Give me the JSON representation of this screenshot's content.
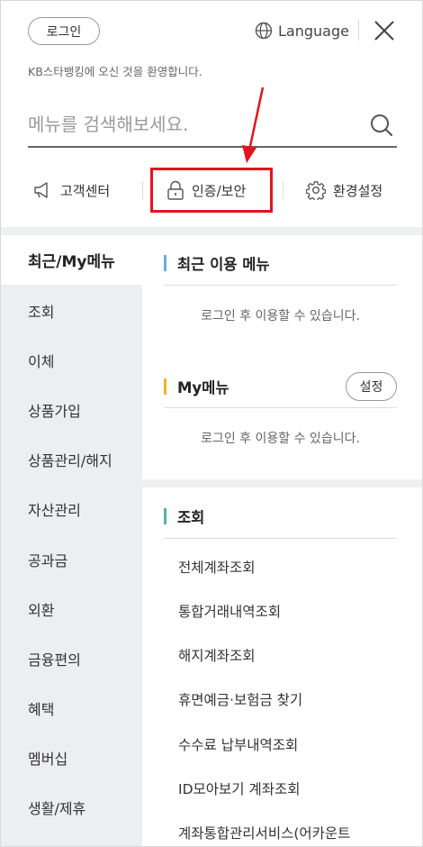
{
  "header": {
    "login_label": "로그인",
    "language_label": "Language",
    "welcome_text": "KB스타뱅킹에 오신 것을 환영합니다."
  },
  "search": {
    "placeholder": "메뉴를 검색해보세요."
  },
  "quick_links": [
    {
      "label": "고객센터",
      "icon": "megaphone-icon"
    },
    {
      "label": "인증/보안",
      "icon": "lock-icon"
    },
    {
      "label": "환경설정",
      "icon": "gear-icon"
    }
  ],
  "annotation": {
    "highlight_color": "#e2141c"
  },
  "left_menu": [
    "최근/My메뉴",
    "조회",
    "이체",
    "상품가입",
    "상품관리/해지",
    "자산관리",
    "공과금",
    "외환",
    "금융편의",
    "혜택",
    "멤버십",
    "생활/제휴"
  ],
  "recent": {
    "title": "최근 이용 메뉴",
    "message": "로그인 후 이용할 수 있습니다.",
    "accent": "#6aaed6"
  },
  "my_menu": {
    "title": "My메뉴",
    "settings_label": "설정",
    "message": "로그인 후 이용할 수 있습니다.",
    "accent": "#f0b429"
  },
  "inquiry": {
    "title": "조회",
    "accent": "#4fb3a6",
    "items": [
      "전체계좌조회",
      "통합거래내역조회",
      "해지계좌조회",
      "휴면예금·보험금 찾기",
      "수수료 납부내역조회",
      "ID모아보기 계좌조회",
      "계좌통합관리서비스(어카운트"
    ]
  }
}
